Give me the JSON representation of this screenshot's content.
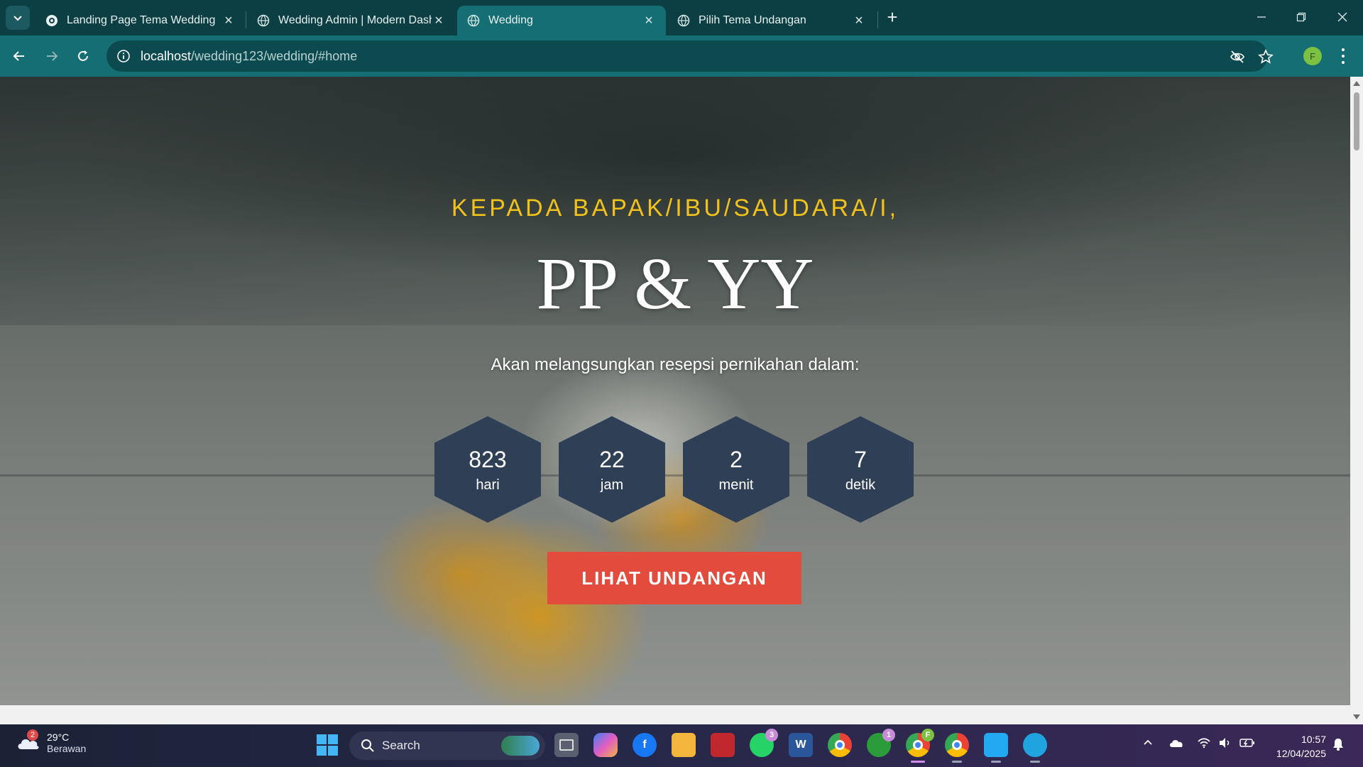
{
  "browser": {
    "tabs": [
      {
        "title": "Landing Page Tema Wedding",
        "icon": "site-icon",
        "active": false
      },
      {
        "title": "Wedding Admin | Modern Dash",
        "icon": "globe-icon",
        "active": false
      },
      {
        "title": "Wedding",
        "icon": "globe-icon",
        "active": true
      },
      {
        "title": "Pilih Tema Undangan",
        "icon": "globe-icon",
        "active": false
      }
    ],
    "url_host": "localhost",
    "url_path": "/wedding123/wedding/#home",
    "profile_initial": "F"
  },
  "page": {
    "greeting": "KEPADA BAPAK/IBU/SAUDARA/I,",
    "couple": "PP & YY",
    "subtitle": "Akan melangsungkan resepsi pernikahan dalam:",
    "countdown": [
      {
        "value": "823",
        "unit": "hari"
      },
      {
        "value": "22",
        "unit": "jam"
      },
      {
        "value": "2",
        "unit": "menit"
      },
      {
        "value": "7",
        "unit": "detik"
      }
    ],
    "cta_label": "LIHAT UNDANGAN"
  },
  "taskbar": {
    "weather_badge": "2",
    "temperature": "29°C",
    "condition": "Berawan",
    "search_label": "Search",
    "whatsapp_badge": "3",
    "xbox_badge": "1",
    "chrome_profile_badge": "F",
    "time": "10:57",
    "date": "12/04/2025"
  },
  "colors": {
    "chrome_dark": "#0b3f44",
    "chrome_teal": "#146e73",
    "greeting_gold": "#f1c21b",
    "hex_navy": "#2f3f56",
    "cta_red": "#e34b3c"
  }
}
